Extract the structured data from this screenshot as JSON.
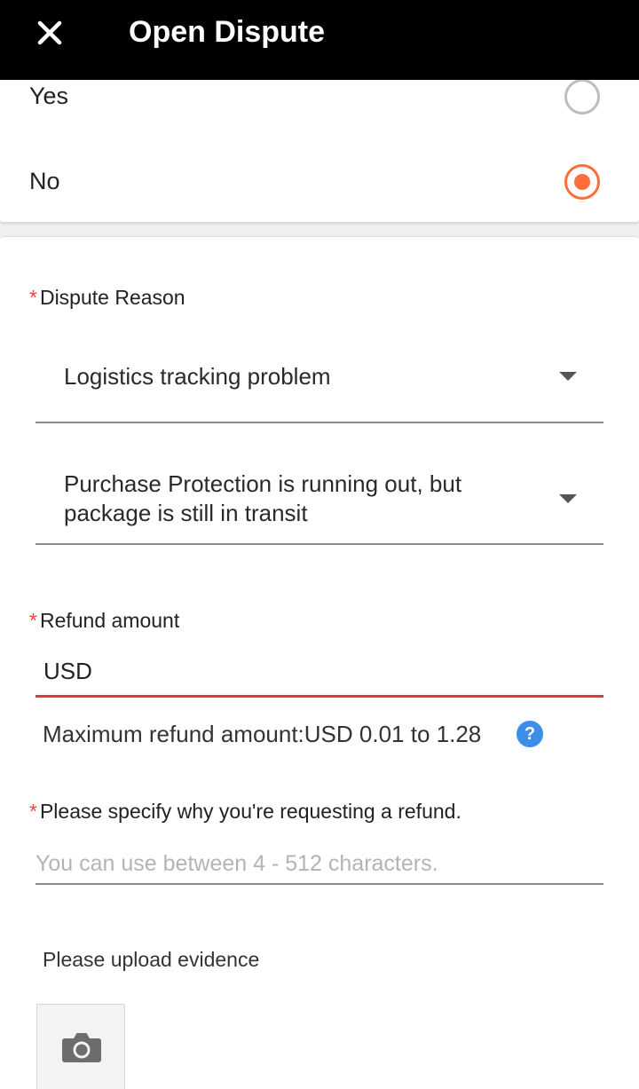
{
  "header": {
    "title": "Open Dispute",
    "close_icon": "close-icon"
  },
  "received_options": {
    "items": [
      {
        "label": "Yes",
        "selected": false
      },
      {
        "label": "No",
        "selected": true
      }
    ],
    "selected_color": "#ff6d3a"
  },
  "dispute_reason": {
    "required_mark": "*",
    "label": "Dispute Reason",
    "primary_value": "Logistics tracking problem",
    "secondary_value": "Purchase Protection is running out, but package is still in transit"
  },
  "refund_amount": {
    "required_mark": "*",
    "label": "Refund amount",
    "currency": "USD",
    "max_text": "Maximum refund amount:USD 0.01 to 1.28",
    "help_glyph": "?",
    "error_color": "#e53935"
  },
  "refund_reason": {
    "required_mark": "*",
    "label": "Please specify why you're requesting a refund.",
    "placeholder": "You can use between 4 - 512 characters."
  },
  "evidence": {
    "label": "Please upload evidence",
    "upload_icon": "camera-icon"
  }
}
